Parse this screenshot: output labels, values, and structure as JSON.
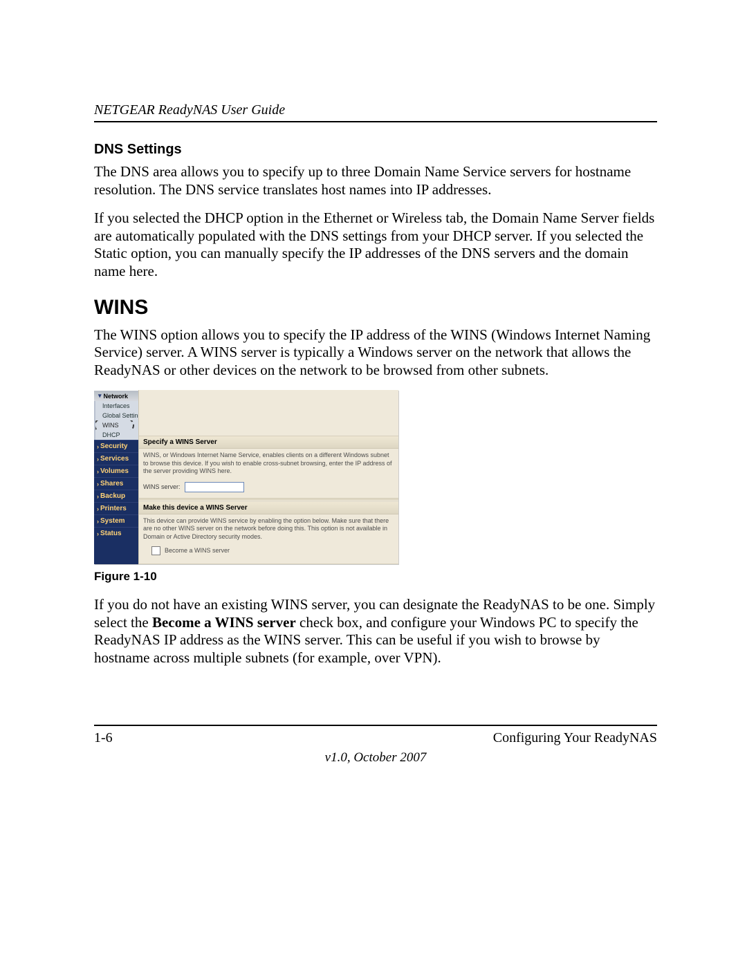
{
  "header": {
    "doc_title": "NETGEAR ReadyNAS User Guide"
  },
  "sections": {
    "dns_heading": "DNS Settings",
    "dns_p1": "The DNS area allows you to specify up to three Domain Name Service servers for hostname resolution. The DNS service translates host names into IP addresses.",
    "dns_p2": "If you selected the DHCP option in the Ethernet or Wireless tab, the Domain Name Server fields are automatically populated with the DNS settings from your DHCP server. If you selected the Static option, you can manually specify the IP addresses of the DNS servers and the domain name here.",
    "wins_heading": "WINS",
    "wins_intro": "The WINS option allows you to specify the IP address of the WINS (Windows Internet Naming Service) server. A WINS server is typically a Windows server on the network that allows the ReadyNAS or other devices on the network to be browsed from other subnets.",
    "fig_caption": "Figure 1-10",
    "after_pre": "If you do not have an existing WINS server, you can designate the ReadyNAS to be one. Simply select the ",
    "after_bold": "Become a WINS server",
    "after_post": " check box, and configure your Windows PC to specify the ReadyNAS IP address as the WINS server. This can be useful if you wish to browse by hostname across multiple subnets (for example, over VPN)."
  },
  "screenshot": {
    "sidebar": {
      "group_network": "Network",
      "sub_interfaces": "Interfaces",
      "sub_global": "Global Settings",
      "sub_wins": "WINS",
      "sub_dhcp": "DHCP",
      "items": [
        "Security",
        "Services",
        "Volumes",
        "Shares",
        "Backup",
        "Printers",
        "System",
        "Status"
      ]
    },
    "panel1": {
      "title": "Specify a WINS Server",
      "desc": "WINS, or Windows Internet Name Service, enables clients on a different Windows subnet to browse this device. If you wish to enable cross-subnet browsing, enter the IP address of the server providing WINS here.",
      "field_label": "WINS server:"
    },
    "panel2": {
      "title": "Make this device a WINS Server",
      "desc": "This device can provide WINS service by enabling the option below. Make sure that there are no other WINS server on the network before doing this. This option is not available in Domain or Active Directory security modes.",
      "checkbox_label": "Become a WINS server"
    }
  },
  "footer": {
    "page_num": "1-6",
    "chapter": "Configuring Your ReadyNAS",
    "version": "v1.0, October 2007"
  }
}
